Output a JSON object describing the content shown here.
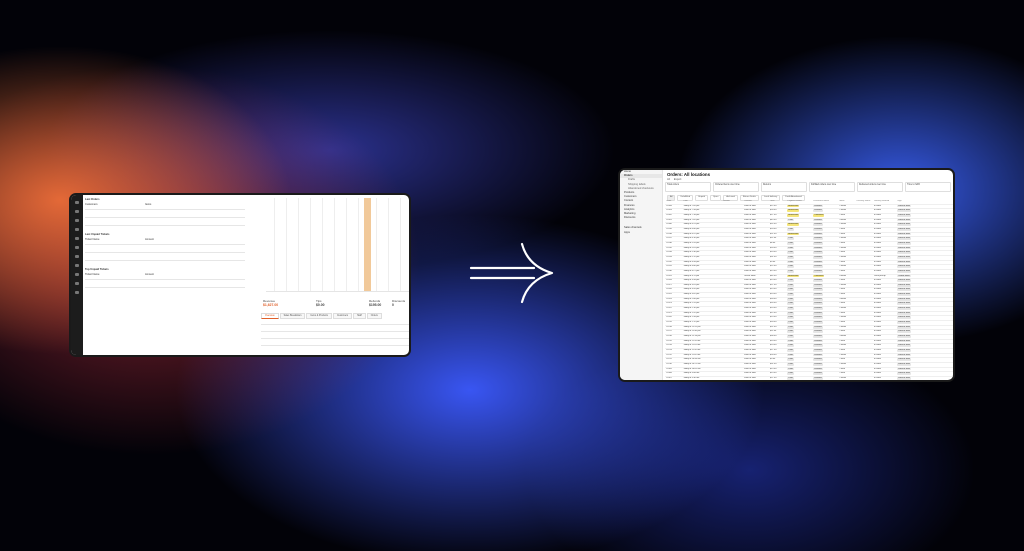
{
  "left_screen": {
    "sections": [
      {
        "title": "Last Orders",
        "sub": "Customers",
        "col": "Items"
      },
      {
        "title": "Last Unpaid Tickets",
        "sub": "Ticket Name",
        "col": "Amount"
      },
      {
        "title": "Top Unpaid Tickets",
        "sub": "Ticket Name",
        "col": "Amount"
      }
    ],
    "metrics": [
      {
        "label": "Revenue",
        "value": "$1,627.00"
      },
      {
        "label": "Tips",
        "value": "$0.00"
      },
      {
        "label": "Refunds",
        "value": "$195.00"
      },
      {
        "label": "Discounts",
        "value": "0"
      }
    ],
    "tabs": [
      "Overview",
      "Sales Breakdown",
      "Items & Products",
      "Customers",
      "Staff",
      "Orders"
    ]
  },
  "right_screen": {
    "sidebar": [
      {
        "label": "Home",
        "active": false,
        "sub": false
      },
      {
        "label": "Orders",
        "active": true,
        "sub": false
      },
      {
        "label": "Drafts",
        "active": false,
        "sub": true
      },
      {
        "label": "Shipping labels",
        "active": false,
        "sub": true
      },
      {
        "label": "Abandoned checkouts",
        "active": false,
        "sub": true
      },
      {
        "label": "Products",
        "active": false,
        "sub": false
      },
      {
        "label": "Customers",
        "active": false,
        "sub": false
      },
      {
        "label": "Content",
        "active": false,
        "sub": false
      },
      {
        "label": "Finances",
        "active": false,
        "sub": false
      },
      {
        "label": "Analytics",
        "active": false,
        "sub": false
      },
      {
        "label": "Marketing",
        "active": false,
        "sub": false
      },
      {
        "label": "Discounts",
        "active": false,
        "sub": false
      },
      {
        "label": "Sales channels",
        "active": false,
        "sub": false
      },
      {
        "label": "Apps",
        "active": false,
        "sub": false
      }
    ],
    "title": "Orders: All locations",
    "tabs": [
      "All",
      "Export"
    ],
    "filters": [
      "Total orders",
      "Ordered items over time",
      "Returns",
      "Fulfilled orders over time",
      "Delivered orders over time",
      "Time to fulfill"
    ],
    "chips": [
      "All",
      "Unfulfilled",
      "Unpaid",
      "Open",
      "Archived",
      "Return Drafts",
      "Local delivery",
      "Draft Abandoned"
    ],
    "columns": [
      "Order",
      "Date",
      "Customer",
      "Channel",
      "Total",
      "Payment status",
      "Fulfillment status",
      "Items",
      "Delivery status",
      "Delivery method",
      "Tags"
    ],
    "rows": [
      [
        "#1044",
        "Today at 7:45 pm",
        "",
        "Point of Sale",
        "$12.00",
        "Authorized",
        "Fulfilled",
        "2 items",
        "",
        "In store",
        "Point of Sale",
        "yellow"
      ],
      [
        "#1043",
        "Today at 7:34 pm",
        "",
        "Point of Sale",
        "$28.00",
        "Authorized",
        "Fulfilled",
        "2 items",
        "",
        "In store",
        "Point of Sale",
        "yellow"
      ],
      [
        "#1042",
        "Today at 7:18 pm",
        "",
        "Point of Sale",
        "$17.00",
        "Authorized",
        "Unfulfilled",
        "1 item",
        "",
        "In store",
        "Point of Sale",
        "yellow"
      ],
      [
        "#1041",
        "Today at 7:02 pm",
        "",
        "Point of Sale",
        "$45.00",
        "Paid",
        "Fulfilled",
        "3 items",
        "",
        "In store",
        "Point of Sale",
        "yellow"
      ],
      [
        "#1040",
        "Today at 6:51 pm",
        "",
        "Point of Sale",
        "$32.00",
        "Authorized",
        "Fulfilled",
        "2 items",
        "",
        "In store",
        "Point of Sale",
        "yellow"
      ],
      [
        "#1039",
        "Today at 6:40 pm",
        "",
        "Point of Sale",
        "$24.00",
        "Paid",
        "Fulfilled",
        "1 item",
        "",
        "In store",
        "Point of Sale",
        "yellow"
      ],
      [
        "#1038",
        "Today at 6:22 pm",
        "",
        "Point of Sale",
        "$21.00",
        "Authorized",
        "Fulfilled",
        "1 item",
        "",
        "In store",
        "Point of Sale",
        "yellow"
      ],
      [
        "#1037",
        "Today at 6:10 pm",
        "",
        "Point of Sale",
        "$11.00",
        "Paid",
        "Fulfilled",
        "2 items",
        "",
        "In store",
        "Point of Sale",
        "yellow"
      ],
      [
        "#1036",
        "Today at 5:59 pm",
        "",
        "Point of Sale",
        "$8.00",
        "Paid",
        "Fulfilled",
        "1 item",
        "",
        "In store",
        "Point of Sale",
        "yellow"
      ],
      [
        "#1035",
        "Today at 5:41 pm",
        "",
        "Point of Sale",
        "$18.00",
        "Paid",
        "Fulfilled",
        "2 items",
        "",
        "In store",
        "Point of Sale",
        "yellow"
      ],
      [
        "#1034",
        "Today at 5:30 pm",
        "",
        "Point of Sale",
        "$14.00",
        "Paid",
        "Fulfilled",
        "1 item",
        "",
        "In store",
        "Point of Sale",
        "yellow"
      ],
      [
        "#1033",
        "Today at 5:12 pm",
        "",
        "Point of Sale",
        "$31.00",
        "Paid",
        "Fulfilled",
        "2 items",
        "",
        "In store",
        "Point of Sale",
        "yellow"
      ],
      [
        "#1032",
        "Today at 4:58 pm",
        "",
        "Point of Sale",
        "$9.00",
        "Paid",
        "Fulfilled",
        "1 item",
        "",
        "In store",
        "Point of Sale",
        "yellow"
      ],
      [
        "#1031",
        "Today at 4:40 pm",
        "",
        "Point of Sale",
        "$22.00",
        "Paid",
        "Fulfilled",
        "2 items",
        "",
        "In store",
        "Point of Sale",
        "yellow"
      ],
      [
        "#1030",
        "Today at 4:27 pm",
        "",
        "Point of Sale",
        "$15.00",
        "Paid",
        "Fulfilled",
        "1 item",
        "",
        "In store",
        "Point of Sale",
        "yellow"
      ],
      [
        "#1029",
        "Today at 4:11 pm",
        "",
        "Online Store",
        "$62.00",
        "Authorized",
        "Unfulfilled",
        "4 items",
        "",
        "Local pickup",
        "Online Store",
        "yellow"
      ],
      [
        "#1028",
        "Today at 3:58 pm",
        "",
        "Point of Sale",
        "$13.00",
        "Paid",
        "Fulfilled",
        "1 item",
        "",
        "In store",
        "Point of Sale",
        "yellow"
      ],
      [
        "#1027",
        "Today at 3:41 pm",
        "",
        "Point of Sale",
        "$27.00",
        "Paid",
        "Fulfilled",
        "2 items",
        "",
        "In store",
        "Point of Sale",
        "yellow"
      ],
      [
        "#1026",
        "Today at 3:20 pm",
        "",
        "Point of Sale",
        "$19.00",
        "Paid",
        "Fulfilled",
        "1 item",
        "",
        "In store",
        "Point of Sale",
        "yellow"
      ],
      [
        "#1025",
        "Today at 3:02 pm",
        "",
        "Point of Sale",
        "$10.00",
        "Paid",
        "Fulfilled",
        "1 item",
        "",
        "In store",
        "Point of Sale",
        "yellow"
      ],
      [
        "#1024",
        "Today at 2:46 pm",
        "",
        "Point of Sale",
        "$34.00",
        "Paid",
        "Fulfilled",
        "3 items",
        "",
        "In store",
        "Point of Sale",
        "yellow"
      ],
      [
        "#1023",
        "Today at 2:31 pm",
        "",
        "Point of Sale",
        "$16.00",
        "Paid",
        "Fulfilled",
        "1 item",
        "",
        "In store",
        "Point of Sale",
        "yellow"
      ],
      [
        "#1022",
        "Today at 2:10 pm",
        "",
        "Point of Sale",
        "$29.00",
        "Paid",
        "Fulfilled",
        "2 items",
        "",
        "In store",
        "Point of Sale",
        "yellow"
      ],
      [
        "#1021",
        "Today at 1:52 pm",
        "",
        "Point of Sale",
        "$12.00",
        "Paid",
        "Fulfilled",
        "1 item",
        "",
        "In store",
        "Point of Sale",
        "yellow"
      ],
      [
        "#1020",
        "Today at 1:34 pm",
        "",
        "Point of Sale",
        "$25.00",
        "Paid",
        "Fulfilled",
        "2 items",
        "",
        "In store",
        "Point of Sale",
        "yellow"
      ],
      [
        "#1019",
        "Today at 1:12 pm",
        "",
        "Point of Sale",
        "$18.00",
        "Paid",
        "Fulfilled",
        "1 item",
        "",
        "In store",
        "Point of Sale",
        "yellow"
      ],
      [
        "#1018",
        "Today at 12:55 pm",
        "",
        "Point of Sale",
        "$21.00",
        "Paid",
        "Fulfilled",
        "2 items",
        "",
        "In store",
        "Point of Sale",
        "yellow"
      ],
      [
        "#1017",
        "Today at 12:40 pm",
        "",
        "Point of Sale",
        "$11.00",
        "Paid",
        "Fulfilled",
        "1 item",
        "",
        "In store",
        "Point of Sale",
        "yellow"
      ],
      [
        "#1016",
        "Today at 12:18 pm",
        "",
        "Point of Sale",
        "$36.00",
        "Paid",
        "Fulfilled",
        "3 items",
        "",
        "In store",
        "Point of Sale",
        "yellow"
      ],
      [
        "#1015",
        "Today at 11:59 am",
        "",
        "Point of Sale",
        "$14.00",
        "Paid",
        "Fulfilled",
        "1 item",
        "",
        "In store",
        "Point of Sale",
        "yellow"
      ],
      [
        "#1014",
        "Today at 11:41 am",
        "",
        "Point of Sale",
        "$23.00",
        "Paid",
        "Fulfilled",
        "2 items",
        "",
        "In store",
        "Point of Sale",
        "yellow"
      ],
      [
        "#1013",
        "Today at 11:20 am",
        "",
        "Point of Sale",
        "$17.00",
        "Paid",
        "Fulfilled",
        "1 item",
        "",
        "In store",
        "Point of Sale",
        "yellow"
      ],
      [
        "#1012",
        "Today at 11:02 am",
        "",
        "Point of Sale",
        "$28.00",
        "Paid",
        "Fulfilled",
        "2 items",
        "",
        "In store",
        "Point of Sale",
        "yellow"
      ],
      [
        "#1011",
        "Today at 10:44 am",
        "",
        "Point of Sale",
        "$9.00",
        "Paid",
        "Fulfilled",
        "1 item",
        "",
        "In store",
        "Point of Sale",
        "yellow"
      ],
      [
        "#1010",
        "Today at 10:21 am",
        "",
        "Point of Sale",
        "$31.00",
        "Paid",
        "Fulfilled",
        "2 items",
        "",
        "In store",
        "Point of Sale",
        "yellow"
      ],
      [
        "#1009",
        "Today at 10:05 am",
        "",
        "Point of Sale",
        "$15.00",
        "Paid",
        "Fulfilled",
        "1 item",
        "",
        "In store",
        "Point of Sale",
        "yellow"
      ],
      [
        "#1008",
        "Today at 9:48 am",
        "",
        "Point of Sale",
        "$19.00",
        "Paid",
        "Fulfilled",
        "1 item",
        "",
        "In store",
        "Point of Sale",
        "yellow"
      ],
      [
        "#1007",
        "Today at 9:30 am",
        "",
        "Point of Sale",
        "$27.00",
        "Paid",
        "Fulfilled",
        "2 items",
        "",
        "In store",
        "Point of Sale",
        "yellow"
      ],
      [
        "#1006",
        "Today at 9:12 am",
        "",
        "Point of Sale",
        "$12.00",
        "Paid",
        "Fulfilled",
        "1 item",
        "",
        "In store",
        "Point of Sale",
        "yellow"
      ]
    ]
  },
  "colors": {
    "accent_orange": "#e0602a",
    "highlight_bar": "#f1c99a",
    "status_yellow": "#f5e57a"
  }
}
